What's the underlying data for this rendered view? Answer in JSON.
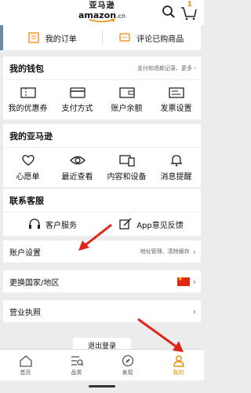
{
  "header": {
    "logo_cn": "亚马逊",
    "logo_en": "amazon",
    "logo_suffix": ".cn",
    "cart_count": "1"
  },
  "orders": {
    "my_orders": "我的订单",
    "review_items": "评论已购商品"
  },
  "wallet": {
    "title": "我的钱包",
    "more": "支付和退款记录、更多",
    "items": [
      {
        "label": "我的优惠券",
        "icon": "coupon-icon"
      },
      {
        "label": "支付方式",
        "icon": "card-icon"
      },
      {
        "label": "账户余额",
        "icon": "wallet-icon"
      },
      {
        "label": "发票设置",
        "icon": "invoice-icon"
      }
    ]
  },
  "amazon": {
    "title": "我的亚马逊",
    "items": [
      {
        "label": "心愿单",
        "icon": "heart-icon"
      },
      {
        "label": "最近查看",
        "icon": "eye-icon"
      },
      {
        "label": "内容和设备",
        "icon": "devices-icon"
      },
      {
        "label": "消息提醒",
        "icon": "bell-icon"
      }
    ]
  },
  "service": {
    "title": "联系客服",
    "customer_service": "客户服务",
    "feedback": "App意见反馈"
  },
  "account": {
    "label": "账户设置",
    "hint": "地址管理、清除缓存"
  },
  "country": {
    "label": "更换国家/地区"
  },
  "license": {
    "label": "营业执照"
  },
  "logout": {
    "label": "退出登录"
  },
  "tabs": [
    {
      "label": "首页",
      "icon": "home-icon"
    },
    {
      "label": "品类",
      "icon": "category-icon"
    },
    {
      "label": "发现",
      "icon": "discover-icon"
    },
    {
      "label": "我的",
      "icon": "profile-icon"
    }
  ],
  "colors": {
    "accent": "#f08804",
    "arrow": "#e0261b",
    "strip": "#6b8ba4"
  }
}
